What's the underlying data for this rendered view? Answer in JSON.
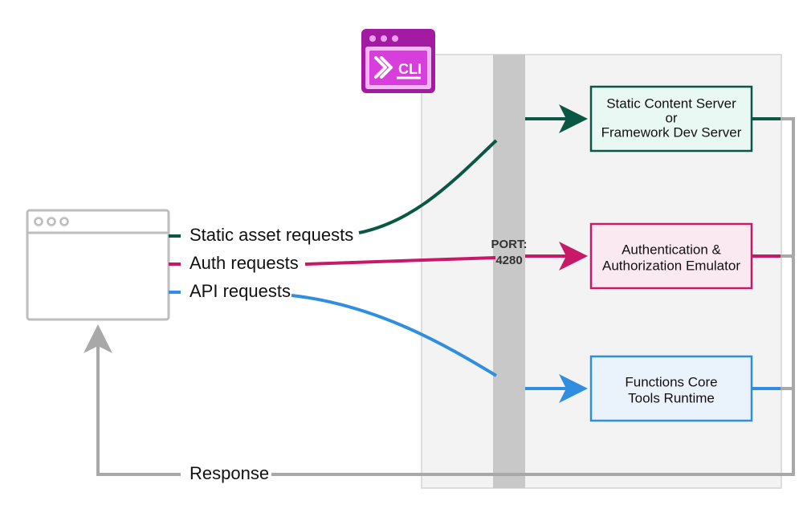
{
  "labels": {
    "static_requests": "Static asset requests",
    "auth_requests": "Auth requests",
    "api_requests": "API requests",
    "response": "Response"
  },
  "port": {
    "label": "PORT:",
    "number": "4280"
  },
  "cli": {
    "label": "CLI"
  },
  "services": {
    "static": {
      "line1": "Static Content Server",
      "line2": "or",
      "line3": "Framework  Dev Server"
    },
    "auth": {
      "line1": "Authentication &",
      "line2": "Authorization Emulator"
    },
    "functions": {
      "line1": "Functions Core",
      "line2": "Tools Runtime"
    }
  },
  "colors": {
    "dark_green": "#0a5744",
    "light_green": "#eaf8f3",
    "magenta": "#c81868",
    "light_pink": "#fbe9f1",
    "blue": "#2f8ee0",
    "light_blue": "#eaf3fb",
    "gray_browser": "#bdbdbd",
    "gray_port": "#c8c8c8",
    "gray_panel": "#f3f3f3",
    "gray_panel_border": "#d4d4d4",
    "gray_response": "#a8a8a8",
    "cli_border": "#a31ba3",
    "cli_fill": "#d83edc",
    "cli_glow": "#f7b5f9"
  }
}
